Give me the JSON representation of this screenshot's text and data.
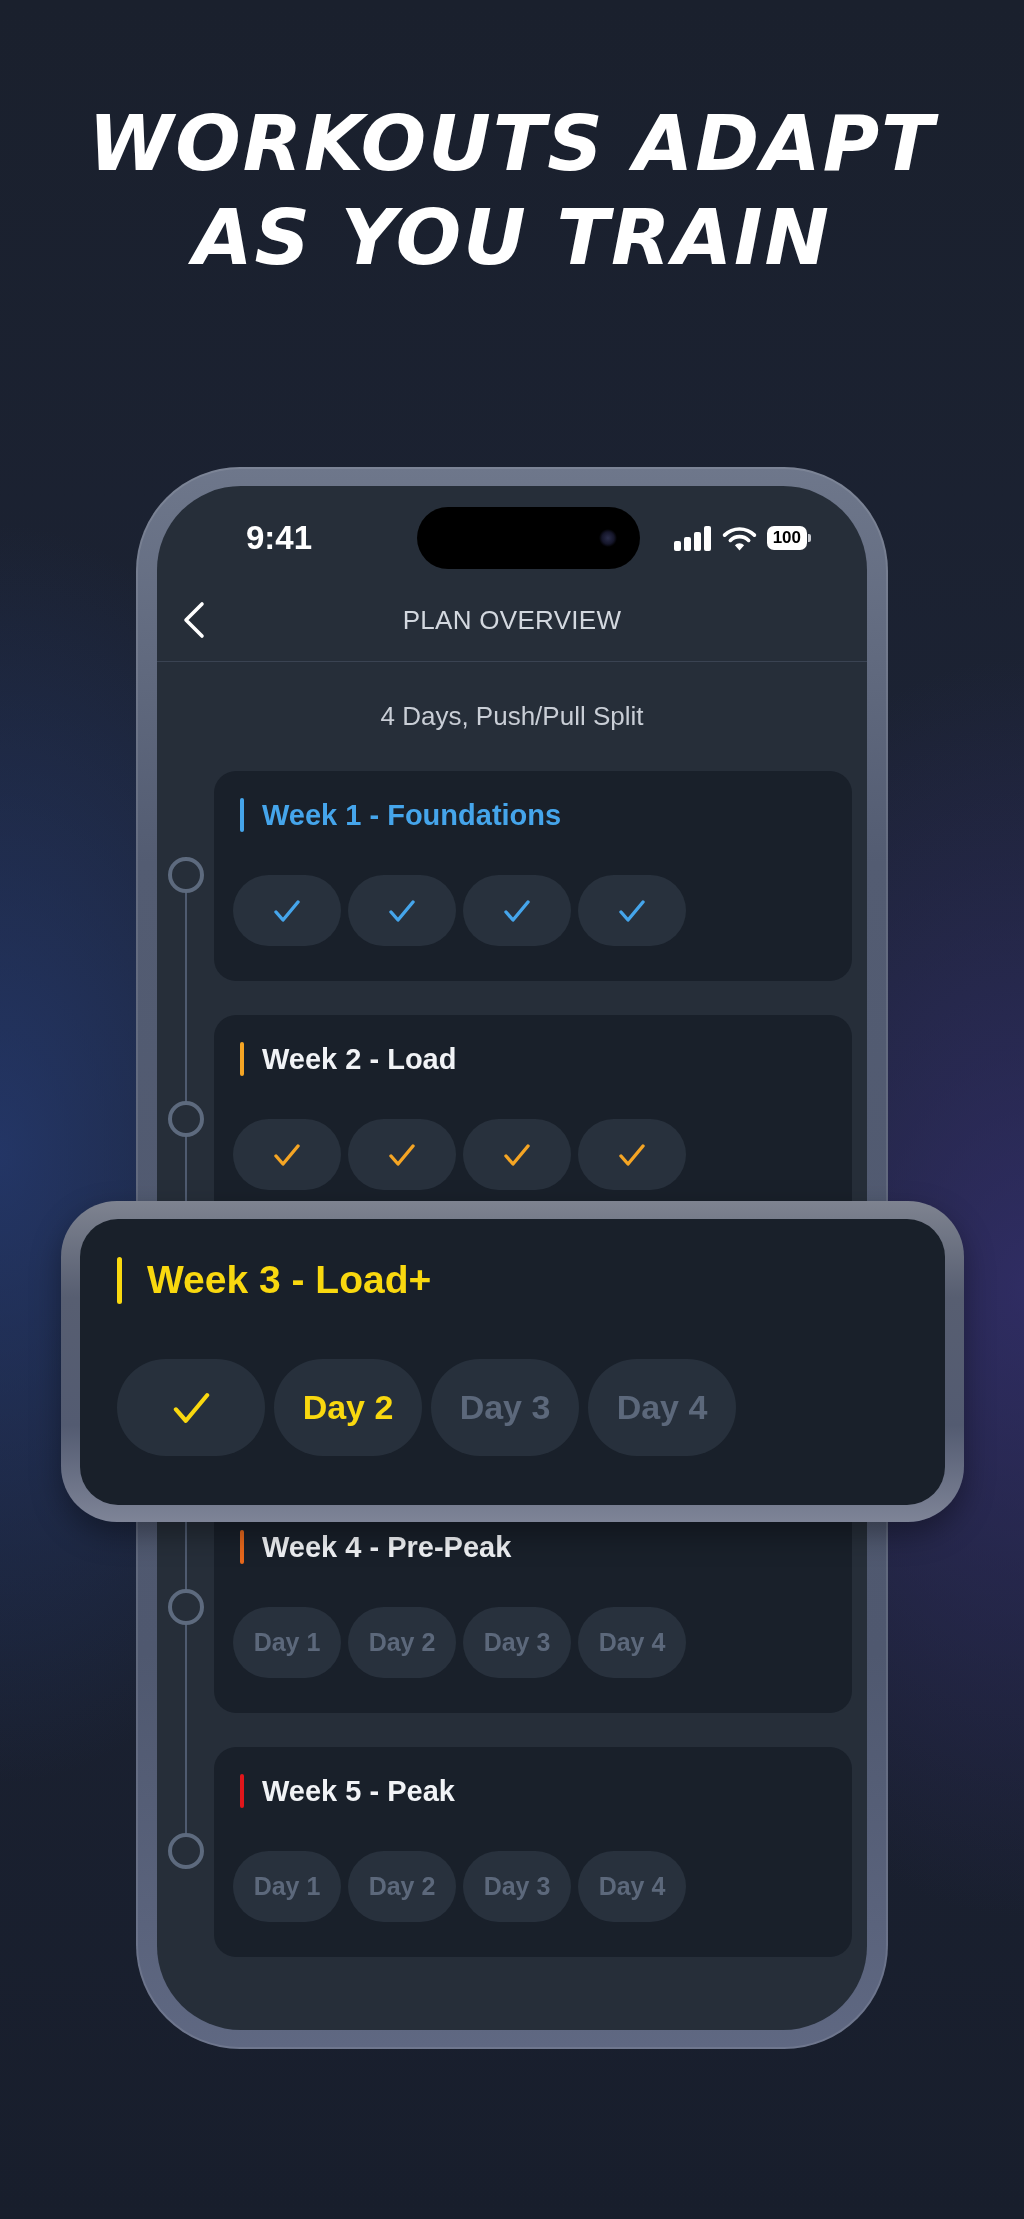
{
  "headline": "WORKOUTS ADAPT AS YOU TRAIN",
  "status_bar": {
    "time": "9:41",
    "battery": "100"
  },
  "nav": {
    "title": "PLAN OVERVIEW"
  },
  "plan": {
    "subtitle": "4 Days, Push/Pull Split"
  },
  "weeks": [
    {
      "title": "Week 1 - Foundations",
      "color": "#45a5eb",
      "title_highlighted": true,
      "featured": false,
      "days": [
        {
          "kind": "done"
        },
        {
          "kind": "done"
        },
        {
          "kind": "done"
        },
        {
          "kind": "done"
        }
      ]
    },
    {
      "title": "Week 2 - Load",
      "color": "#f5a524",
      "title_highlighted": false,
      "featured": false,
      "days": [
        {
          "kind": "done"
        },
        {
          "kind": "done"
        },
        {
          "kind": "done"
        },
        {
          "kind": "done"
        }
      ]
    },
    {
      "title": "Week 3 - Load+",
      "color": "#f9d80f",
      "title_highlighted": true,
      "featured": true,
      "days": [
        {
          "kind": "done"
        },
        {
          "kind": "current",
          "label": "Day 2"
        },
        {
          "kind": "upcoming",
          "label": "Day 3"
        },
        {
          "kind": "upcoming",
          "label": "Day 4"
        }
      ]
    },
    {
      "title": "Week 4 - Pre-Peak",
      "color": "#e8681c",
      "title_highlighted": false,
      "featured": false,
      "days": [
        {
          "kind": "upcoming",
          "label": "Day 1"
        },
        {
          "kind": "upcoming",
          "label": "Day 2"
        },
        {
          "kind": "upcoming",
          "label": "Day 3"
        },
        {
          "kind": "upcoming",
          "label": "Day 4"
        }
      ]
    },
    {
      "title": "Week 5 - Peak",
      "color": "#e0161b",
      "title_highlighted": false,
      "featured": false,
      "days": [
        {
          "kind": "upcoming",
          "label": "Day 1"
        },
        {
          "kind": "upcoming",
          "label": "Day 2"
        },
        {
          "kind": "upcoming",
          "label": "Day 3"
        },
        {
          "kind": "upcoming",
          "label": "Day 4"
        }
      ]
    }
  ]
}
